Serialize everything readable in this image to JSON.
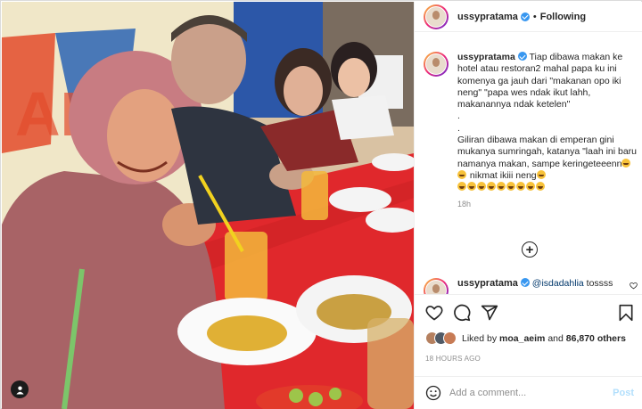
{
  "post": {
    "username": "ussypratama",
    "follow_status": "Following",
    "separator": "•",
    "caption": "Tiap dibawa makan ke hotel atau restoran2 mahal papa ku ini komenya ga jauh dari \"makanan opo iki neng\" \"papa wes ndak ikut lahh, makanannya ndak ketelen\"\n.\n.\nGiliran dibawa makan di emperan gini mukanya sumringah, katanya \"laah ini baru namanya makan, sampe keringeteeenn",
    "caption_tail": " nikmat ikiii neng",
    "caption_time": "18h",
    "reply_username": "ussypratama",
    "reply_mention": "@isdadahlia",
    "reply_text": " tossss",
    "liked_by_prefix": "Liked by ",
    "liked_by_user": "moa_aeim",
    "liked_by_and": " and ",
    "liked_by_count": "86,870 others",
    "posted_ago": "18 HOURS AGO",
    "comment_placeholder": "Add a comment...",
    "post_button": "Post"
  },
  "icons": [
    "verified-badge-icon",
    "heart-icon",
    "comment-icon",
    "share-icon",
    "bookmark-icon",
    "emoji-icon",
    "plus-circle-icon",
    "user-tag-icon"
  ],
  "colors": {
    "verified": "#3897f0",
    "post_disabled": "#b2dffc",
    "muted": "#8e8e8e",
    "text": "#262626"
  }
}
